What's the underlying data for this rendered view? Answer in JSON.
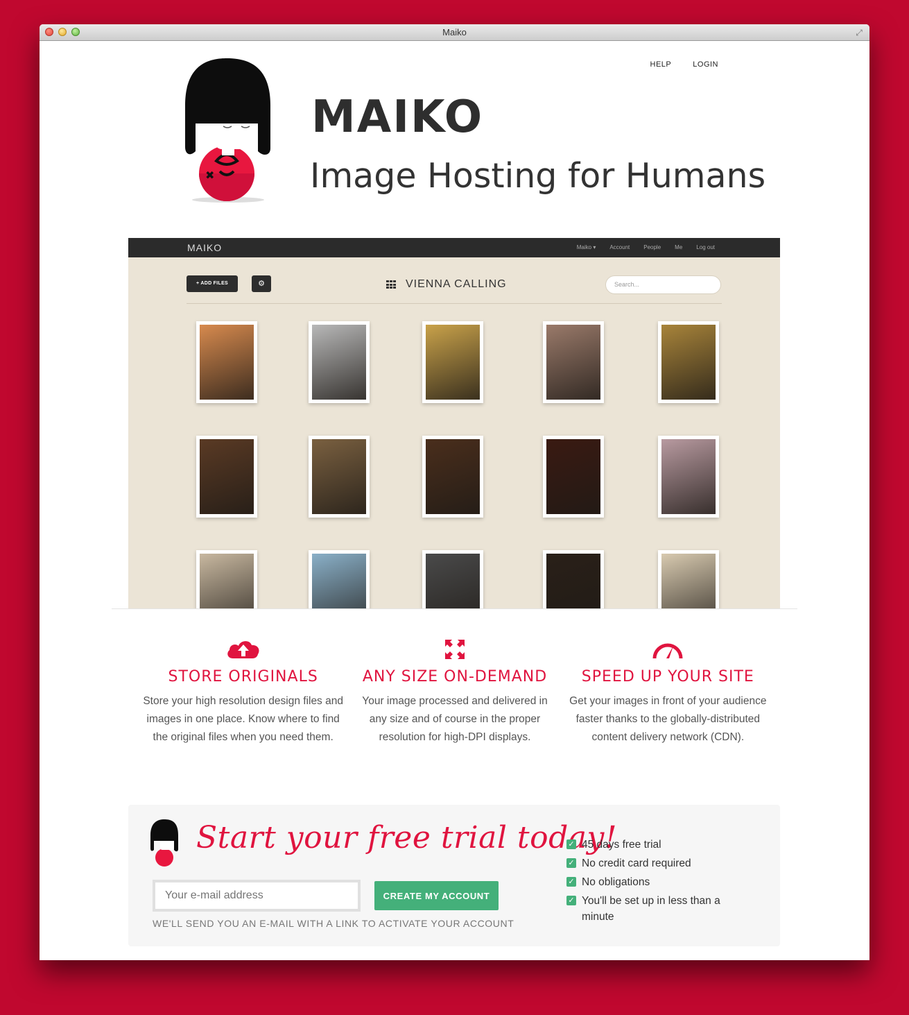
{
  "window": {
    "title": "Maiko"
  },
  "nav": {
    "help": "HELP",
    "login": "LOGIN"
  },
  "hero": {
    "brand": "MAIKO",
    "tagline": "Image Hosting for Humans"
  },
  "app_screenshot": {
    "logo": "MAIKO",
    "menu": [
      "Maiko ▾",
      "Account",
      "People",
      "Me",
      "Log out"
    ],
    "add_files_label": "+ ADD FILES",
    "album_title": "VIENNA CALLING",
    "search_placeholder": "Search...",
    "photo_colors": [
      [
        "#d78a4e",
        "#b8b8b8",
        "#c9a24a",
        "#9a7a6a",
        "#a8843a"
      ],
      [
        "#5a3a24",
        "#7a6040",
        "#4a2e1c",
        "#3a1a12",
        "#b89aa0"
      ],
      [
        "#c8b8a0",
        "#8ab0c8",
        "#4a4a4a",
        "#2a2018",
        "#d8cab0"
      ]
    ]
  },
  "features": [
    {
      "icon": "cloud-upload-icon",
      "title": "STORE ORIGINALS",
      "text": "Store your high resolution design files and images in one place. Know where to find the original files when you need them."
    },
    {
      "icon": "expand-icon",
      "title": "ANY SIZE ON-DEMAND",
      "text": "Your image processed and delivered in any size and of course in the proper resolution for high-DPI displays."
    },
    {
      "icon": "speedometer-icon",
      "title": "SPEED UP YOUR SITE",
      "text": "Get your images in front of your audience faster thanks to the globally-distributed content delivery network (CDN)."
    }
  ],
  "trial": {
    "title": "Start your free trial today!",
    "email_placeholder": "Your e-mail address",
    "button_label": "CREATE MY ACCOUNT",
    "note": "WE'LL SEND YOU AN E-MAIL WITH A LINK TO ACTIVATE YOUR ACCOUNT",
    "benefits": [
      "45 days free trial",
      "No credit card required",
      "No obligations",
      "You'll be set up in less than a minute"
    ]
  },
  "colors": {
    "background": "#c0082f",
    "accent": "#e0143f",
    "button": "#44b07a"
  }
}
